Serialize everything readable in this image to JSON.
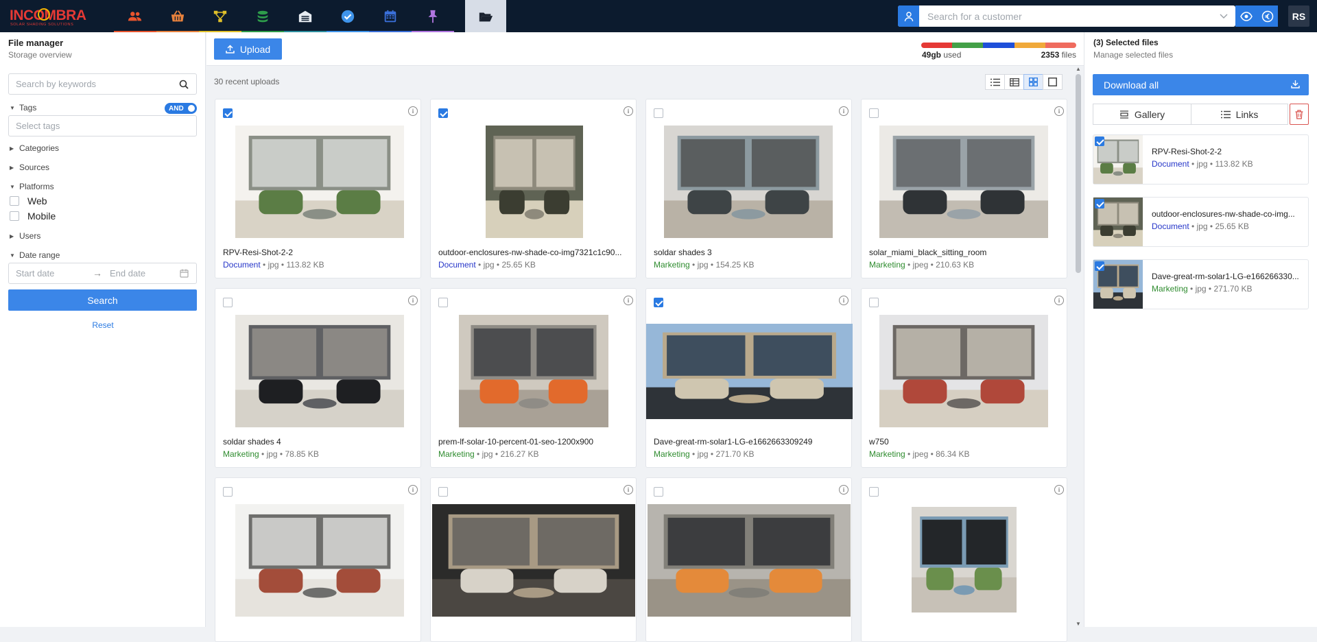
{
  "brand": {
    "name": "INCOMBRA",
    "tagline": "SOLAR SHADING SOLUTIONS"
  },
  "nav": [
    {
      "name": "people",
      "color": "#e8542d",
      "bar": "#e8542d"
    },
    {
      "name": "basket",
      "color": "#e8823d",
      "bar": "#e8823d"
    },
    {
      "name": "hierarchy",
      "color": "#e0c02a",
      "bar": "#e0c02a"
    },
    {
      "name": "coins",
      "color": "#2e9c4b",
      "bar": "#2e9c4b"
    },
    {
      "name": "warehouse",
      "color": "#e7ecf2",
      "bar": "#2d8fa0"
    },
    {
      "name": "check-badge",
      "color": "#3f94ea",
      "bar": "#3f94ea"
    },
    {
      "name": "calendar",
      "color": "#3a6fd8",
      "bar": "#3a6fd8"
    },
    {
      "name": "pin",
      "color": "#b076e0",
      "bar": "#b076e0"
    },
    {
      "name": "folder-open",
      "color": "#1b2330",
      "bar": "#d7dde7"
    }
  ],
  "topbar": {
    "customer_placeholder": "Search for a customer",
    "avatar": "RS"
  },
  "sidebar": {
    "title": "File manager",
    "subtitle": "Storage overview",
    "search_placeholder": "Search by keywords",
    "tags_label": "Tags",
    "and_label": "AND",
    "tags_placeholder": "Select tags",
    "categories": "Categories",
    "sources": "Sources",
    "platforms": "Platforms",
    "platform_web": "Web",
    "platform_mobile": "Mobile",
    "users": "Users",
    "date_range": "Date range",
    "start_date": "Start date",
    "end_date": "End date",
    "search_button": "Search",
    "reset": "Reset"
  },
  "main": {
    "upload": "Upload",
    "storage_used_value": "49gb",
    "storage_used_label": "used",
    "files_count": "2353",
    "files_label": "files",
    "storage_segments": [
      "#e53935",
      "#43a047",
      "#1e4fd9",
      "#f0a93a",
      "#ef6b5e"
    ],
    "recent": "30 recent uploads"
  },
  "cards": [
    {
      "name": "RPV-Resi-Shot-2-2",
      "category": "Document",
      "ext": "jpg",
      "size": "113.82 KB",
      "checked": true
    },
    {
      "name": "outdoor-enclosures-nw-shade-co-img7321c1c90...",
      "category": "Document",
      "ext": "jpg",
      "size": "25.65 KB",
      "checked": true
    },
    {
      "name": "soldar shades 3",
      "category": "Marketing",
      "ext": "jpg",
      "size": "154.25 KB",
      "checked": false
    },
    {
      "name": "solar_miami_black_sitting_room",
      "category": "Marketing",
      "ext": "jpeg",
      "size": "210.63 KB",
      "checked": false
    },
    {
      "name": "soldar shades 4",
      "category": "Marketing",
      "ext": "jpg",
      "size": "78.85 KB",
      "checked": false
    },
    {
      "name": "prem-lf-solar-10-percent-01-seo-1200x900",
      "category": "Marketing",
      "ext": "jpg",
      "size": "216.27 KB",
      "checked": false
    },
    {
      "name": "Dave-great-rm-solar1-LG-e1662663309249",
      "category": "Marketing",
      "ext": "jpg",
      "size": "271.70 KB",
      "checked": true
    },
    {
      "name": "w750",
      "category": "Marketing",
      "ext": "jpeg",
      "size": "86.34 KB",
      "checked": false
    },
    {
      "name": "",
      "category": "",
      "ext": "",
      "size": "",
      "checked": false
    },
    {
      "name": "",
      "category": "",
      "ext": "",
      "size": "",
      "checked": false
    },
    {
      "name": "",
      "category": "",
      "ext": "",
      "size": "",
      "checked": false
    },
    {
      "name": "",
      "category": "",
      "ext": "",
      "size": "",
      "checked": false
    }
  ],
  "right": {
    "title": "(3) Selected files",
    "subtitle": "Manage selected files",
    "download_all": "Download all",
    "gallery": "Gallery",
    "links": "Links",
    "selected": [
      {
        "name": "RPV-Resi-Shot-2-2",
        "category": "Document",
        "ext": "jpg",
        "size": "113.82 KB"
      },
      {
        "name": "outdoor-enclosures-nw-shade-co-img...",
        "category": "Document",
        "ext": "jpg",
        "size": "25.65 KB"
      },
      {
        "name": "Dave-great-rm-solar1-LG-e166266330...",
        "category": "Marketing",
        "ext": "jpg",
        "size": "271.70 KB"
      }
    ]
  }
}
